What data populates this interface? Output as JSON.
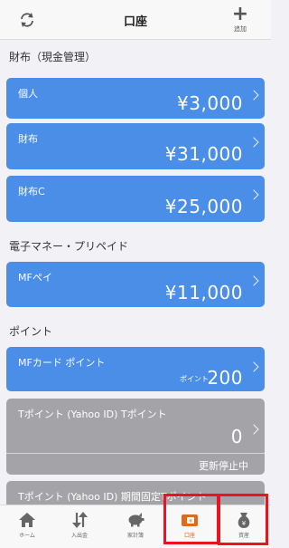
{
  "header": {
    "title": "口座",
    "add_label": "追加"
  },
  "sections": [
    {
      "title": "財布（現金管理）"
    },
    {
      "title": "電子マネー・プリペイド"
    },
    {
      "title": "ポイント"
    }
  ],
  "accounts": [
    {
      "name": "個人",
      "amount": "¥3,000"
    },
    {
      "name": "財布",
      "amount": "¥31,000"
    },
    {
      "name": "財布C",
      "amount": "¥25,000"
    },
    {
      "name": "MFペイ",
      "amount": "¥11,000"
    },
    {
      "name": "MFカード ポイント",
      "prefix": "ポイント",
      "amount": "200"
    },
    {
      "name": "Tポイント (Yahoo ID) Tポイント",
      "amount": "0",
      "status": "更新停止中"
    },
    {
      "name": "Tポイント (Yahoo ID) 期間固定Tポイント"
    }
  ],
  "tabs": [
    {
      "label": "ホーム",
      "icon": "home-icon"
    },
    {
      "label": "入出金",
      "icon": "transfer-icon"
    },
    {
      "label": "家計簿",
      "icon": "piggy-bank-icon"
    },
    {
      "label": "口座",
      "icon": "wallet-icon",
      "active": true
    },
    {
      "label": "資産",
      "icon": "money-bag-icon"
    }
  ],
  "colors": {
    "card_blue": "#4a8ee8",
    "card_gray": "#a4a4a8",
    "active_tab": "#e06a1b",
    "highlight": "#e8141f"
  }
}
